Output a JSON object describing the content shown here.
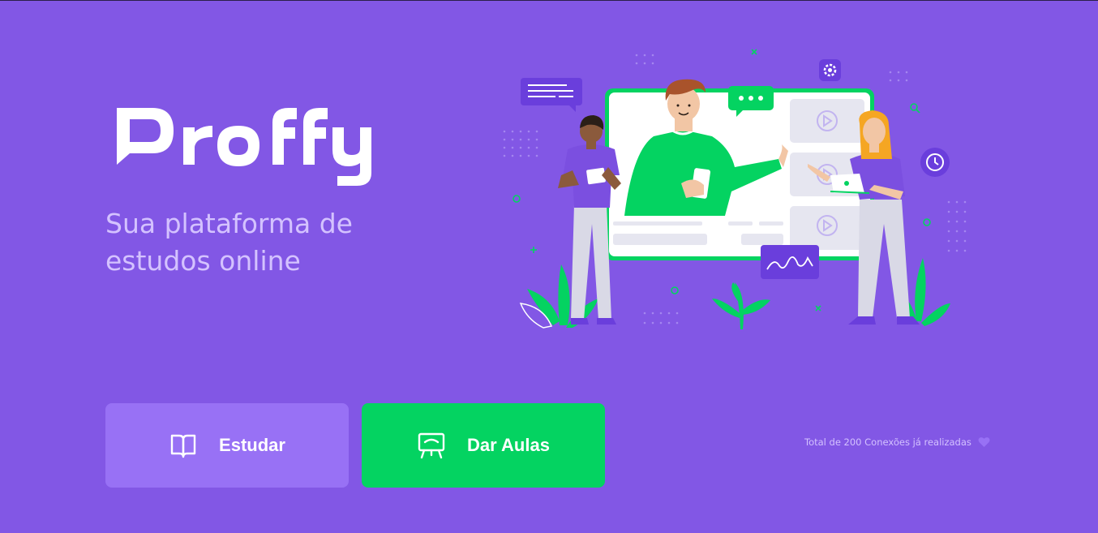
{
  "brand": {
    "name": "Proffy",
    "tagline": "Sua plataforma de estudos online"
  },
  "actions": {
    "study_label": "Estudar",
    "give_classes_label": "Dar Aulas"
  },
  "footer": {
    "connections_text": "Total de 200 Conexões já realizadas"
  },
  "icons": {
    "study": "book-open-icon",
    "give_classes": "presentation-board-icon",
    "connections": "heart-icon",
    "settings": "gear-icon",
    "clock": "clock-icon",
    "chat": "chat-bubble-icon",
    "play": "play-icon"
  },
  "colors": {
    "background": "#8257E5",
    "primary_light": "#9871F5",
    "secondary": "#04D361",
    "tagline": "#D4C2FF"
  }
}
